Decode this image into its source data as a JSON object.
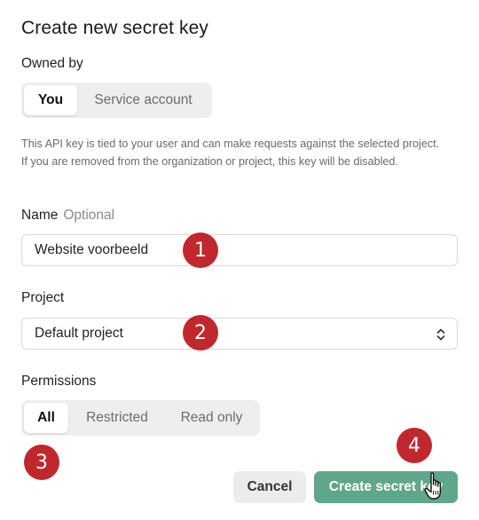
{
  "dialog": {
    "title": "Create new secret key"
  },
  "owned_by": {
    "label": "Owned by",
    "options": [
      "You",
      "Service account"
    ],
    "selected": "You"
  },
  "help_text": "This API key is tied to your user and can make requests against the selected project. If you are removed from the organization or project, this key will be disabled.",
  "name": {
    "label": "Name",
    "optional_label": "Optional",
    "value": "Website voorbeeld"
  },
  "project": {
    "label": "Project",
    "value": "Default project"
  },
  "permissions": {
    "label": "Permissions",
    "options": [
      "All",
      "Restricted",
      "Read only"
    ],
    "selected": "All"
  },
  "actions": {
    "cancel_label": "Cancel",
    "create_label": "Create secret key"
  },
  "annotations": {
    "badge_1": "1",
    "badge_2": "2",
    "badge_3": "3",
    "badge_4": "4",
    "badge_color": "#c0282d"
  },
  "colors": {
    "primary_button": "#5fa78a",
    "segmented_bg": "#eeeeee"
  },
  "icons": {
    "select_chevron": "chevron-up-down-icon",
    "pointer": "hand-pointer-icon"
  }
}
